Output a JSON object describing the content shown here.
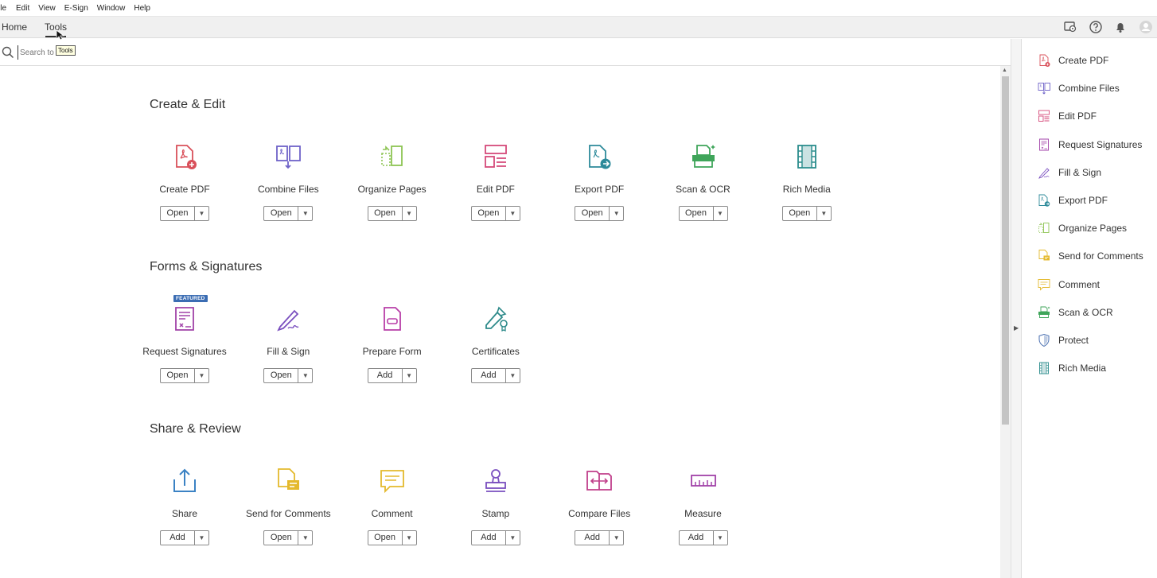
{
  "menu": [
    "ile",
    "Edit",
    "View",
    "E-Sign",
    "Window",
    "Help"
  ],
  "tabs": {
    "home": "Home",
    "tools": "Tools"
  },
  "search": {
    "placeholder": "Search to",
    "tooltip": "Tools"
  },
  "sections": [
    {
      "title": "Create & Edit",
      "tools": [
        {
          "label": "Create PDF",
          "button": "Open",
          "icon": "create-pdf-icon",
          "color": "#d9505a"
        },
        {
          "label": "Combine Files",
          "button": "Open",
          "icon": "combine-files-icon",
          "color": "#6f63c8"
        },
        {
          "label": "Organize Pages",
          "button": "Open",
          "icon": "organize-pages-icon",
          "color": "#8dc453"
        },
        {
          "label": "Edit PDF",
          "button": "Open",
          "icon": "edit-pdf-icon",
          "color": "#d54a7a"
        },
        {
          "label": "Export PDF",
          "button": "Open",
          "icon": "export-pdf-icon",
          "color": "#2d8a9a"
        },
        {
          "label": "Scan & OCR",
          "button": "Open",
          "icon": "scan-ocr-icon",
          "color": "#3fa55a"
        },
        {
          "label": "Rich Media",
          "button": "Open",
          "icon": "rich-media-icon",
          "color": "#2a8c8c"
        }
      ]
    },
    {
      "title": "Forms & Signatures",
      "tools": [
        {
          "label": "Request Signatures",
          "button": "Open",
          "icon": "request-signatures-icon",
          "color": "#a142a8",
          "badge": "FEATURED"
        },
        {
          "label": "Fill & Sign",
          "button": "Open",
          "icon": "fill-sign-icon",
          "color": "#7a4fbf"
        },
        {
          "label": "Prepare Form",
          "button": "Add",
          "icon": "prepare-form-icon",
          "color": "#b83ea8"
        },
        {
          "label": "Certificates",
          "button": "Add",
          "icon": "certificates-icon",
          "color": "#2d8a8a"
        }
      ]
    },
    {
      "title": "Share & Review",
      "tools": [
        {
          "label": "Share",
          "button": "Add",
          "icon": "share-icon",
          "color": "#3b82c4"
        },
        {
          "label": "Send for Comments",
          "button": "Open",
          "icon": "send-for-comments-icon",
          "color": "#e4b92d"
        },
        {
          "label": "Comment",
          "button": "Open",
          "icon": "comment-icon",
          "color": "#e4b92d"
        },
        {
          "label": "Stamp",
          "button": "Add",
          "icon": "stamp-icon",
          "color": "#7a4fbf"
        },
        {
          "label": "Compare Files",
          "button": "Add",
          "icon": "compare-files-icon",
          "color": "#c03e8a"
        },
        {
          "label": "Measure",
          "button": "Add",
          "icon": "measure-icon",
          "color": "#a142a8"
        }
      ]
    }
  ],
  "right_panel": [
    {
      "label": "Create PDF",
      "icon": "create-pdf-icon"
    },
    {
      "label": "Combine Files",
      "icon": "combine-files-icon"
    },
    {
      "label": "Edit PDF",
      "icon": "edit-pdf-icon"
    },
    {
      "label": "Request Signatures",
      "icon": "request-signatures-icon"
    },
    {
      "label": "Fill & Sign",
      "icon": "fill-sign-icon"
    },
    {
      "label": "Export PDF",
      "icon": "export-pdf-icon"
    },
    {
      "label": "Organize Pages",
      "icon": "organize-pages-icon"
    },
    {
      "label": "Send for Comments",
      "icon": "send-for-comments-icon"
    },
    {
      "label": "Comment",
      "icon": "comment-icon"
    },
    {
      "label": "Scan & OCR",
      "icon": "scan-ocr-icon"
    },
    {
      "label": "Protect",
      "icon": "protect-icon"
    },
    {
      "label": "Rich Media",
      "icon": "rich-media-icon"
    }
  ]
}
